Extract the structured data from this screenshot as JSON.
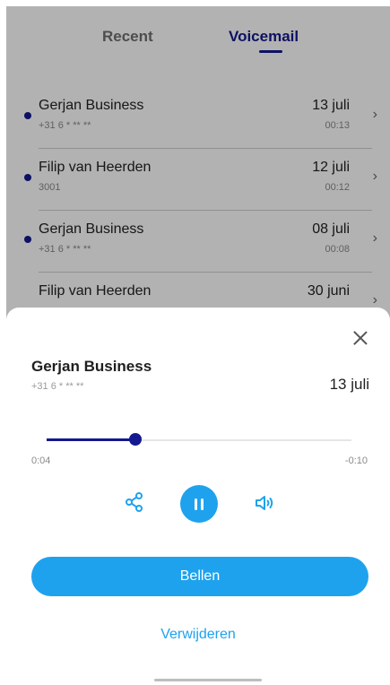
{
  "tabs": {
    "recent": "Recent",
    "voicemail": "Voicemail"
  },
  "voicemails": [
    {
      "name": "Gerjan Business",
      "number": "+31 6 * ** **",
      "date": "13 juli",
      "duration": "00:13",
      "unread": true
    },
    {
      "name": "Filip van Heerden",
      "number": "3001",
      "date": "12 juli",
      "duration": "00:12",
      "unread": true
    },
    {
      "name": "Gerjan Business",
      "number": "+31 6 * ** **",
      "date": "08 juli",
      "duration": "00:08",
      "unread": true
    },
    {
      "name": "Filip van Heerden",
      "number": "",
      "date": "30 juni",
      "duration": "",
      "unread": false
    }
  ],
  "sheet": {
    "name": "Gerjan Business",
    "number": "+31 6 * ** **",
    "date": "13 juli",
    "elapsed": "0:04",
    "remaining": "-0:10",
    "progress": 0.29,
    "call_label": "Bellen",
    "delete_label": "Verwijderen"
  },
  "icons": {
    "share": "share-icon",
    "pause": "pause-icon",
    "speaker": "speaker-icon",
    "close": "close-icon",
    "chevron": "chevron-right-icon"
  },
  "colors": {
    "accent_blue": "#1ea2ee",
    "navy": "#13198f"
  }
}
